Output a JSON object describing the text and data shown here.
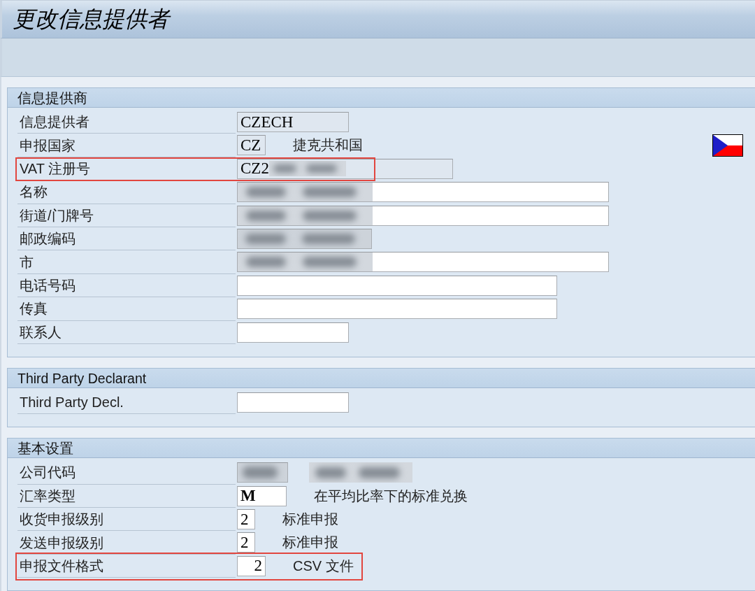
{
  "window": {
    "title": "更改信息提供者"
  },
  "sections": [
    {
      "title": "信息提供商",
      "rows": [
        {
          "kind": "field",
          "label": "信息提供者",
          "field": {
            "value": "CZECH",
            "editable": false,
            "redacted": false
          },
          "highlighted": false
        },
        {
          "kind": "country",
          "label": "申报国家",
          "field": {
            "value": "CZ",
            "editable": false,
            "redacted": false
          },
          "description": "捷克共和国",
          "highlighted": false
        },
        {
          "kind": "field",
          "label": "VAT 注册号",
          "field": {
            "value": "CZ2",
            "editable": false,
            "redacted": true
          },
          "highlighted": true
        },
        {
          "kind": "field",
          "label": "名称",
          "field": {
            "editable": true,
            "redacted": true
          },
          "highlighted": false
        },
        {
          "kind": "field",
          "label": "街道/门牌号",
          "field": {
            "editable": true,
            "redacted": true
          },
          "highlighted": false
        },
        {
          "kind": "field",
          "label": "邮政编码",
          "field": {
            "editable": false,
            "redacted": true
          },
          "highlighted": false
        },
        {
          "kind": "field",
          "label": "市",
          "field": {
            "editable": true,
            "redacted": true
          },
          "highlighted": false
        },
        {
          "kind": "field",
          "label": "电话号码",
          "field": {
            "editable": true,
            "redacted": false
          },
          "highlighted": false
        },
        {
          "kind": "field",
          "label": "传真",
          "field": {
            "editable": true,
            "redacted": false
          },
          "highlighted": false
        },
        {
          "kind": "field",
          "label": "联系人",
          "field": {
            "editable": true,
            "redacted": false
          },
          "highlighted": false
        }
      ]
    },
    {
      "title": "Third Party Declarant",
      "rows": [
        {
          "kind": "field",
          "label": "Third Party Decl.",
          "field": {
            "editable": true,
            "redacted": false
          },
          "highlighted": false
        }
      ]
    },
    {
      "title": "基本设置",
      "rows": [
        {
          "kind": "field",
          "label": "公司代码",
          "field": {
            "editable": false,
            "redacted": true
          },
          "description_redacted": true,
          "highlighted": false
        },
        {
          "kind": "field",
          "label": "汇率类型",
          "field": {
            "value": "M",
            "editable": true,
            "redacted": false
          },
          "description": "在平均比率下的标准兑换",
          "highlighted": false
        },
        {
          "kind": "field",
          "label": "收货申报级别",
          "field": {
            "value": "2",
            "editable": true,
            "redacted": false
          },
          "description": "标准申报",
          "highlighted": false
        },
        {
          "kind": "field",
          "label": "发送申报级别",
          "field": {
            "value": "2",
            "editable": true,
            "redacted": false
          },
          "description": "标准申报",
          "highlighted": false
        },
        {
          "kind": "field",
          "label": "申报文件格式",
          "field": {
            "value": "2",
            "editable": true,
            "redacted": false
          },
          "description": "CSV 文件",
          "highlighted": true
        }
      ]
    }
  ]
}
